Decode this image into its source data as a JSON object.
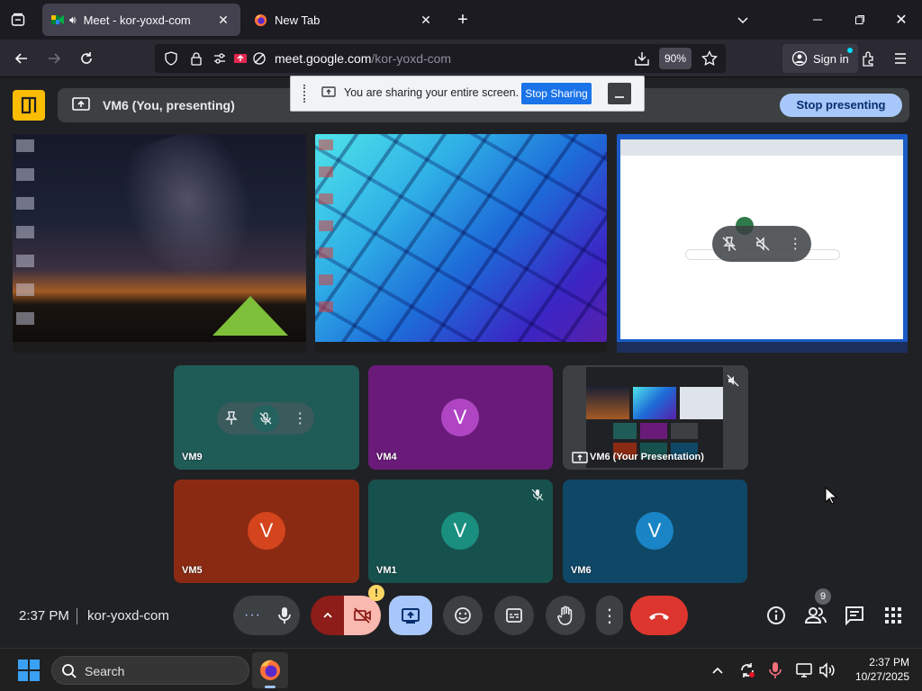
{
  "browser": {
    "tabs": [
      {
        "title": "Meet - kor-yoxd-com",
        "active": true
      },
      {
        "title": "New Tab",
        "active": false
      }
    ],
    "url_host": "meet.google.com",
    "url_path": "/kor-yoxd-com",
    "zoom": "90%",
    "signin_label": "Sign in"
  },
  "meet": {
    "presenting_label": "VM6 (You, presenting)",
    "share_notice": "You are sharing your entire screen.",
    "stop_sharing_label": "Stop Sharing",
    "stop_presenting_label": "Stop presenting",
    "participants": [
      {
        "name": "VM9",
        "initial": "",
        "color": "#1f5b57"
      },
      {
        "name": "VM4",
        "initial": "V",
        "color": "#6a1b7a",
        "avatar_color": "#b045c3"
      },
      {
        "name": "VM6 (Your Presentation)",
        "initial": "",
        "color": "#3c4043"
      },
      {
        "name": "VM5",
        "initial": "V",
        "color": "#8a2a12",
        "avatar_color": "#d4441d"
      },
      {
        "name": "VM1",
        "initial": "V",
        "color": "#17514d",
        "avatar_color": "#1a8f80"
      },
      {
        "name": "VM6",
        "initial": "V",
        "color": "#0f4766",
        "avatar_color": "#1a85c6"
      }
    ],
    "time": "2:37 PM",
    "meeting_code": "kor-yoxd-com",
    "participants_count": "9"
  },
  "taskbar": {
    "search_label": "Search",
    "time": "2:37 PM",
    "date": "10/27/2025"
  }
}
